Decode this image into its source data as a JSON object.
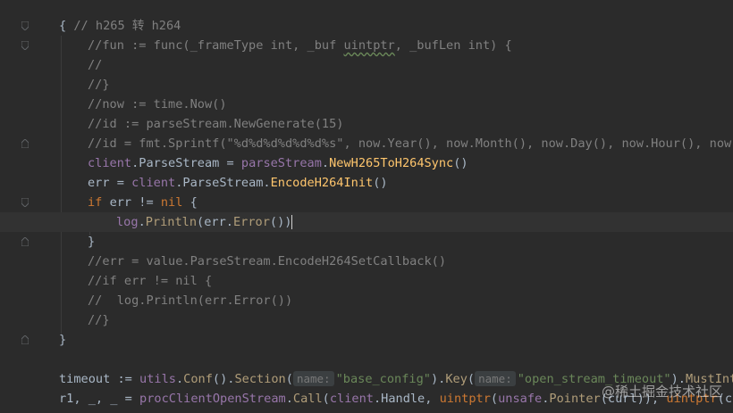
{
  "editor": {
    "lines": [
      {
        "tokens": [
          [
            "pl",
            "{ "
          ],
          [
            "c",
            "// h265 转 h264"
          ]
        ]
      },
      {
        "indent": 1,
        "tokens": [
          [
            "c",
            "//fun := func(_frameType int, _buf "
          ],
          [
            "c squig",
            "uintptr"
          ],
          [
            "c",
            ", _bufLen int) {"
          ]
        ]
      },
      {
        "indent": 1,
        "tokens": [
          [
            "c",
            "//"
          ]
        ]
      },
      {
        "indent": 1,
        "tokens": [
          [
            "c",
            "//}"
          ]
        ]
      },
      {
        "indent": 1,
        "tokens": [
          [
            "c",
            "//now := time.Now()"
          ]
        ]
      },
      {
        "indent": 1,
        "tokens": [
          [
            "c",
            "//id := parseStream.NewGenerate(15)"
          ]
        ]
      },
      {
        "indent": 1,
        "tokens": [
          [
            "c",
            "//id = fmt.Sprintf(\"%d%d%d%d%d%d%s\", now.Year(), now.Month(), now.Day(), now.Hour(), now.Mi"
          ]
        ]
      },
      {
        "indent": 1,
        "tokens": [
          [
            "pk",
            "client"
          ],
          [
            "pl",
            "."
          ],
          [
            "pl",
            "ParseStream"
          ],
          [
            "pl",
            " = "
          ],
          [
            "pk",
            "parseStream"
          ],
          [
            "pl",
            "."
          ],
          [
            "fn",
            "NewH265ToH264Sync"
          ],
          [
            "pl",
            "()"
          ]
        ]
      },
      {
        "indent": 1,
        "tokens": [
          [
            "pl",
            "err = "
          ],
          [
            "pk",
            "client"
          ],
          [
            "pl",
            "."
          ],
          [
            "pl",
            "ParseStream."
          ],
          [
            "fn",
            "EncodeH264Init"
          ],
          [
            "pl",
            "()"
          ]
        ]
      },
      {
        "indent": 1,
        "tokens": [
          [
            "kw",
            "if "
          ],
          [
            "pl",
            "err != "
          ],
          [
            "kw",
            "nil "
          ],
          [
            "pl",
            "{"
          ]
        ]
      },
      {
        "indent": 2,
        "current": true,
        "tokens": [
          [
            "pk",
            "log"
          ],
          [
            "pl",
            "."
          ],
          [
            "fc",
            "Println"
          ],
          [
            "pl",
            "(err."
          ],
          [
            "fc",
            "Error"
          ],
          [
            "pl",
            "())"
          ]
        ]
      },
      {
        "indent": 1,
        "tokens": [
          [
            "pl",
            "}"
          ]
        ]
      },
      {
        "indent": 1,
        "tokens": [
          [
            "c",
            "//err = value.ParseStream.EncodeH264SetCallback()"
          ]
        ]
      },
      {
        "indent": 1,
        "tokens": [
          [
            "c",
            "//if err != nil {"
          ]
        ]
      },
      {
        "indent": 1,
        "tokens": [
          [
            "c",
            "//  log.Println(err.Error())"
          ]
        ]
      },
      {
        "indent": 1,
        "tokens": [
          [
            "c",
            "//}"
          ]
        ]
      },
      {
        "tokens": [
          [
            "pl",
            "}"
          ]
        ]
      },
      {
        "tokens": []
      },
      {
        "tokens": [
          [
            "pl",
            "timeout := "
          ],
          [
            "pk",
            "utils"
          ],
          [
            "pl",
            "."
          ],
          [
            "fc",
            "Conf"
          ],
          [
            "pl",
            "()."
          ],
          [
            "fc",
            "Section"
          ],
          [
            "pl",
            "("
          ],
          [
            "hint",
            "name:"
          ],
          [
            "st",
            "\"base_config\""
          ],
          [
            "pl",
            ")."
          ],
          [
            "fc",
            "Key"
          ],
          [
            "pl",
            "("
          ],
          [
            "hint",
            "name:"
          ],
          [
            "st",
            "\"open_stream_timeout\""
          ],
          [
            "pl",
            ")."
          ],
          [
            "fc",
            "MustInt"
          ],
          [
            "pl",
            "("
          ]
        ]
      },
      {
        "tokens": [
          [
            "pl",
            "r1, _, _ = "
          ],
          [
            "pk",
            "procClientOpenStream"
          ],
          [
            "pl",
            "."
          ],
          [
            "fc",
            "Call"
          ],
          [
            "pl",
            "("
          ],
          [
            "pk",
            "client"
          ],
          [
            "pl",
            ".Handle, "
          ],
          [
            "kw",
            "uintptr"
          ],
          [
            "pl",
            "("
          ],
          [
            "pk",
            "unsafe"
          ],
          [
            "pl",
            "."
          ],
          [
            "fc",
            "Pointer"
          ],
          [
            "pl",
            "(curl)), "
          ],
          [
            "kw",
            "uintptr"
          ],
          [
            "pl",
            "(cli"
          ]
        ]
      }
    ]
  },
  "watermark": "@稀土掘金技术社区"
}
